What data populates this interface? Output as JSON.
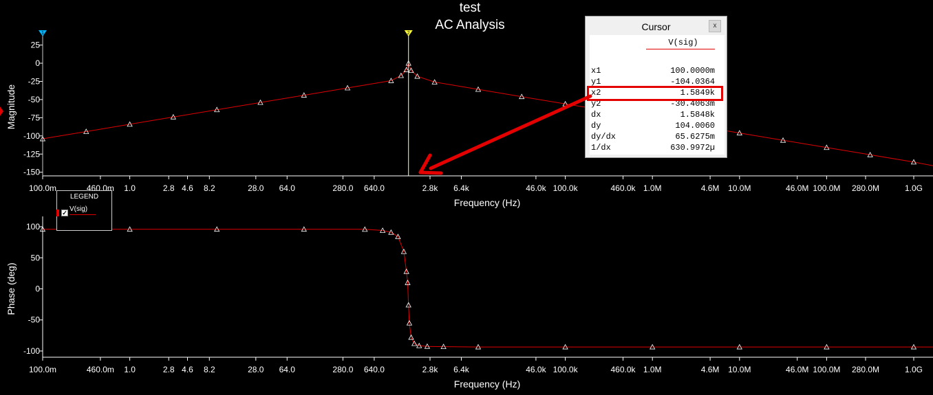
{
  "titles": [
    "test",
    "AC Analysis"
  ],
  "colors": {
    "background": "#000000",
    "trace": "#e00000",
    "axis": "#ffffff",
    "cursor1": "#00b7ff",
    "cursor2": "#ffff33",
    "highlight": "#e50000"
  },
  "chart_data": [
    {
      "type": "line",
      "title": "AC Analysis",
      "xlabel": "Frequency (Hz)",
      "ylabel": "Magnitude",
      "xscale": "log",
      "xlim": [
        0.1,
        1000000000
      ],
      "ylim": [
        -155,
        35
      ],
      "yticks": [
        25,
        0,
        -25,
        -50,
        -75,
        -100,
        -125,
        -150
      ],
      "xtick_labels": [
        "100.0m",
        "460.0m",
        "1.0",
        "2.8",
        "4.6",
        "8.2",
        "28.0",
        "64.0",
        "280.0",
        "640.0",
        "2.8k",
        "6.4k",
        "46.0k",
        "100.0k",
        "460.0k",
        "1.0M",
        "4.6M",
        "10.0M",
        "46.0M",
        "100.0M",
        "280.0M",
        "1.0G"
      ],
      "grid": false,
      "series": [
        {
          "name": "V(sig)",
          "x": [
            0.1,
            0.316,
            1,
            3.16,
            10,
            31.6,
            100,
            316,
            1000,
            1300,
            1500,
            1585,
            1700,
            2000,
            3160,
            10000,
            31600,
            100000,
            316000,
            1000000,
            3160000,
            10000000,
            31600000,
            100000000,
            316000000,
            1000000000,
            1800000000
          ],
          "values": [
            -104,
            -94,
            -84,
            -74,
            -64,
            -54,
            -44,
            -34,
            -24,
            -17,
            -9,
            -0.03,
            -10,
            -18,
            -26,
            -36,
            -46,
            -56,
            -66,
            -76,
            -86,
            -96,
            -106,
            -116,
            -126,
            -136,
            -141
          ]
        }
      ],
      "cursors": [
        {
          "label": "1",
          "x": 0.1
        },
        {
          "label": "2",
          "x": 1585
        }
      ]
    },
    {
      "type": "line",
      "xlabel": "Frequency (Hz)",
      "ylabel": "Phase (deg)",
      "xscale": "log",
      "xlim": [
        0.1,
        1000000000
      ],
      "ylim": [
        -110,
        110
      ],
      "yticks": [
        100,
        50,
        0,
        -50,
        -100
      ],
      "xtick_labels": [
        "100.0m",
        "460.0m",
        "1.0",
        "2.8",
        "4.6",
        "8.2",
        "28.0",
        "64.0",
        "280.0",
        "640.0",
        "2.8k",
        "6.4k",
        "46.0k",
        "100.0k",
        "460.0k",
        "1.0M",
        "4.6M",
        "10.0M",
        "46.0M",
        "100.0M",
        "280.0M",
        "1.0G"
      ],
      "grid": false,
      "legend": {
        "title": "LEGEND",
        "entries": [
          "V(sig)"
        ],
        "placement": "top-left"
      },
      "series": [
        {
          "name": "V(sig)",
          "x": [
            0.1,
            1,
            10,
            100,
            500,
            800,
            1000,
            1200,
            1400,
            1500,
            1550,
            1585,
            1620,
            1700,
            1850,
            2100,
            2600,
            4000,
            10000,
            100000,
            1000000,
            10000000,
            100000000,
            1000000000,
            1800000000
          ],
          "values": [
            96,
            96,
            96,
            96,
            95.8,
            94,
            91,
            84,
            60,
            28,
            10,
            -26,
            -55,
            -78,
            -88,
            -91.5,
            -92.5,
            -93,
            -93.5,
            -93.5,
            -93.5,
            -93.5,
            -93.5,
            -93.5,
            -93.5
          ]
        }
      ]
    }
  ],
  "cursor_window": {
    "title": "Cursor",
    "close": "x",
    "column": "V(sig)",
    "rows": [
      {
        "key": "x1",
        "value": "100.0000m"
      },
      {
        "key": "y1",
        "value": "-104.0364"
      },
      {
        "key": "x2",
        "value": "1.5849k"
      },
      {
        "key": "y2",
        "value": "-30.4063m"
      },
      {
        "key": "dx",
        "value": "1.5848k"
      },
      {
        "key": "dy",
        "value": "104.0060"
      },
      {
        "key": "dy/dx",
        "value": "65.6275m"
      },
      {
        "key": "1/dx",
        "value": "630.9972µ"
      }
    ],
    "highlighted_row": "x2"
  }
}
